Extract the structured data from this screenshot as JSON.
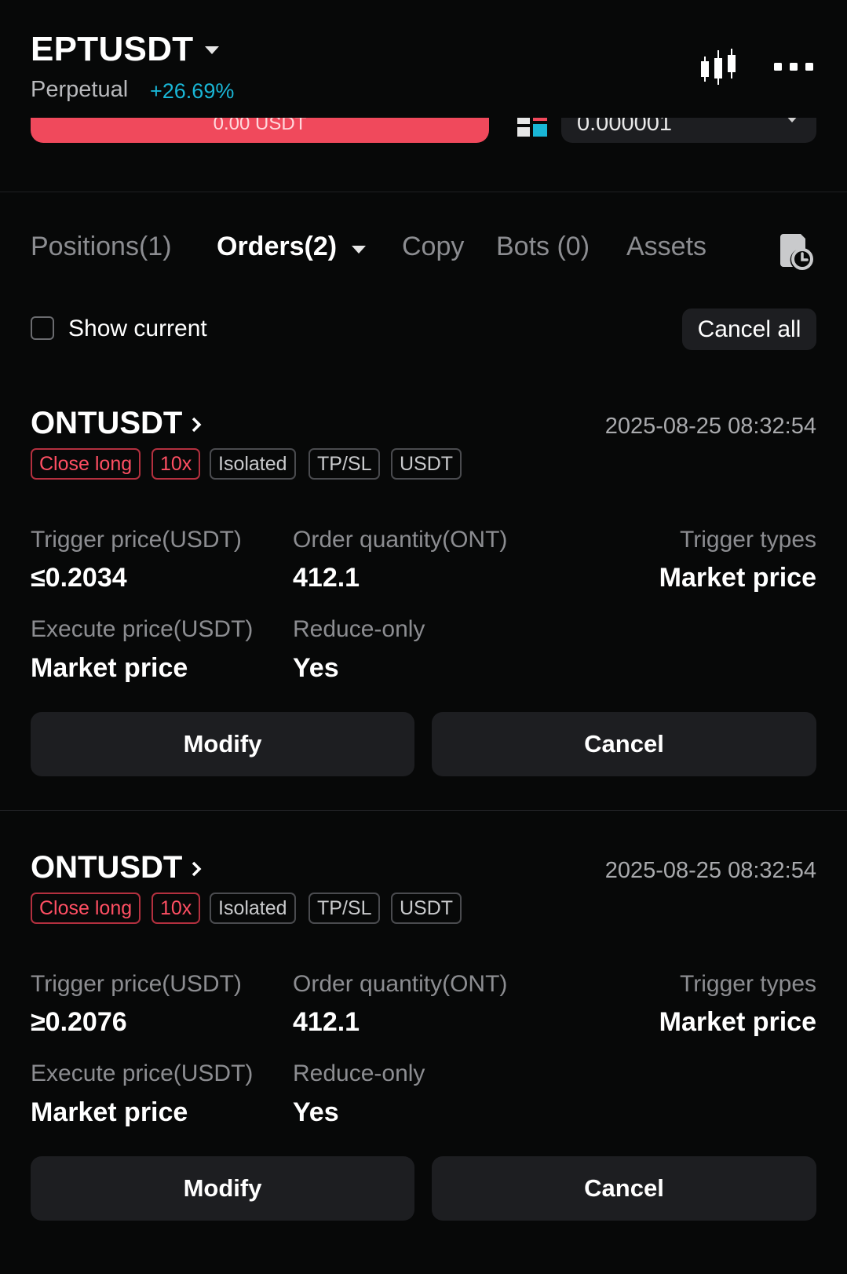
{
  "header": {
    "symbol": "EPTUSDT",
    "contract_type": "Perpetual",
    "change": "+26.69%",
    "change_color": "#19b6d6",
    "icons": [
      "candlestick-chart-icon",
      "more-icon"
    ]
  },
  "order_panel": {
    "sell_button_text": "0.00 USDT",
    "sell_color": "#f0495c",
    "precision_value": "0.000001"
  },
  "tabs": {
    "positions": "Positions(1)",
    "orders": "Orders(2)",
    "copy": "Copy",
    "bots": "Bots (0)",
    "assets": "Assets"
  },
  "filter": {
    "show_current_label": "Show current",
    "show_current_checked": false,
    "cancel_all_label": "Cancel all"
  },
  "orders": [
    {
      "symbol": "ONTUSDT",
      "time": "2025-08-25 08:32:54",
      "tags": [
        "Close long",
        "10x",
        "Isolated",
        "TP/SL",
        "USDT"
      ],
      "trigger_price_label": "Trigger price(USDT)",
      "trigger_price": "≤0.2034",
      "quantity_label": "Order quantity(ONT)",
      "quantity": "412.1",
      "trigger_type_label": "Trigger types",
      "trigger_type": "Market price",
      "execute_price_label": "Execute price(USDT)",
      "execute_price": "Market price",
      "reduce_only_label": "Reduce-only",
      "reduce_only": "Yes",
      "modify_label": "Modify",
      "cancel_label": "Cancel"
    },
    {
      "symbol": "ONTUSDT",
      "time": "2025-08-25 08:32:54",
      "tags": [
        "Close long",
        "10x",
        "Isolated",
        "TP/SL",
        "USDT"
      ],
      "trigger_price_label": "Trigger price(USDT)",
      "trigger_price": "≥0.2076",
      "quantity_label": "Order quantity(ONT)",
      "quantity": "412.1",
      "trigger_type_label": "Trigger types",
      "trigger_type": "Market price",
      "execute_price_label": "Execute price(USDT)",
      "execute_price": "Market price",
      "reduce_only_label": "Reduce-only",
      "reduce_only": "Yes",
      "modify_label": "Modify",
      "cancel_label": "Cancel"
    }
  ]
}
